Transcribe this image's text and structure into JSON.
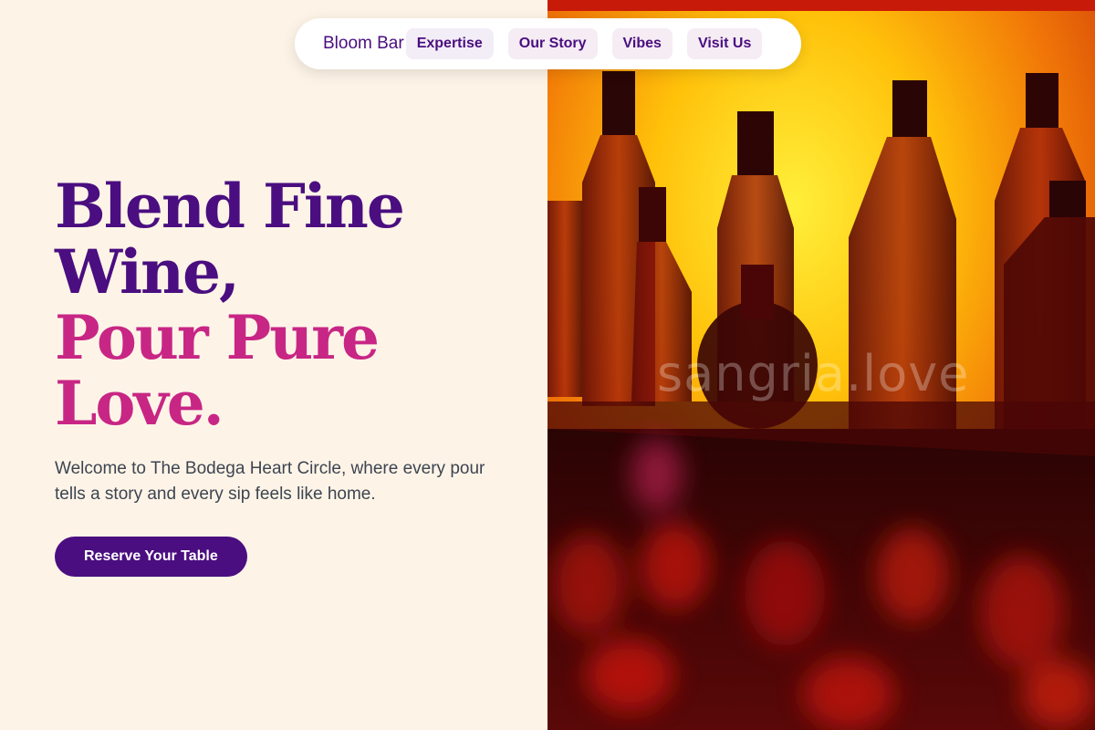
{
  "nav": {
    "brand": "Bloom Bar",
    "links": [
      "Expertise",
      "Our Story",
      "Vibes",
      "Visit Us"
    ]
  },
  "hero": {
    "headline_line1": "Blend Fine",
    "headline_line2": "Wine,",
    "headline_line3": "Pour Pure",
    "headline_line4": "Love.",
    "subtitle": "Welcome to The Bodega Heart Circle, where every pour tells a story and every sip feels like home.",
    "cta_label": "Reserve Your Table"
  },
  "image": {
    "watermark": "sangria.love",
    "subject": "wine-bottles-backlit"
  },
  "colors": {
    "background": "#fdf4e7",
    "primary": "#4a0e80",
    "accent": "#c82685",
    "text": "#3d4451"
  }
}
